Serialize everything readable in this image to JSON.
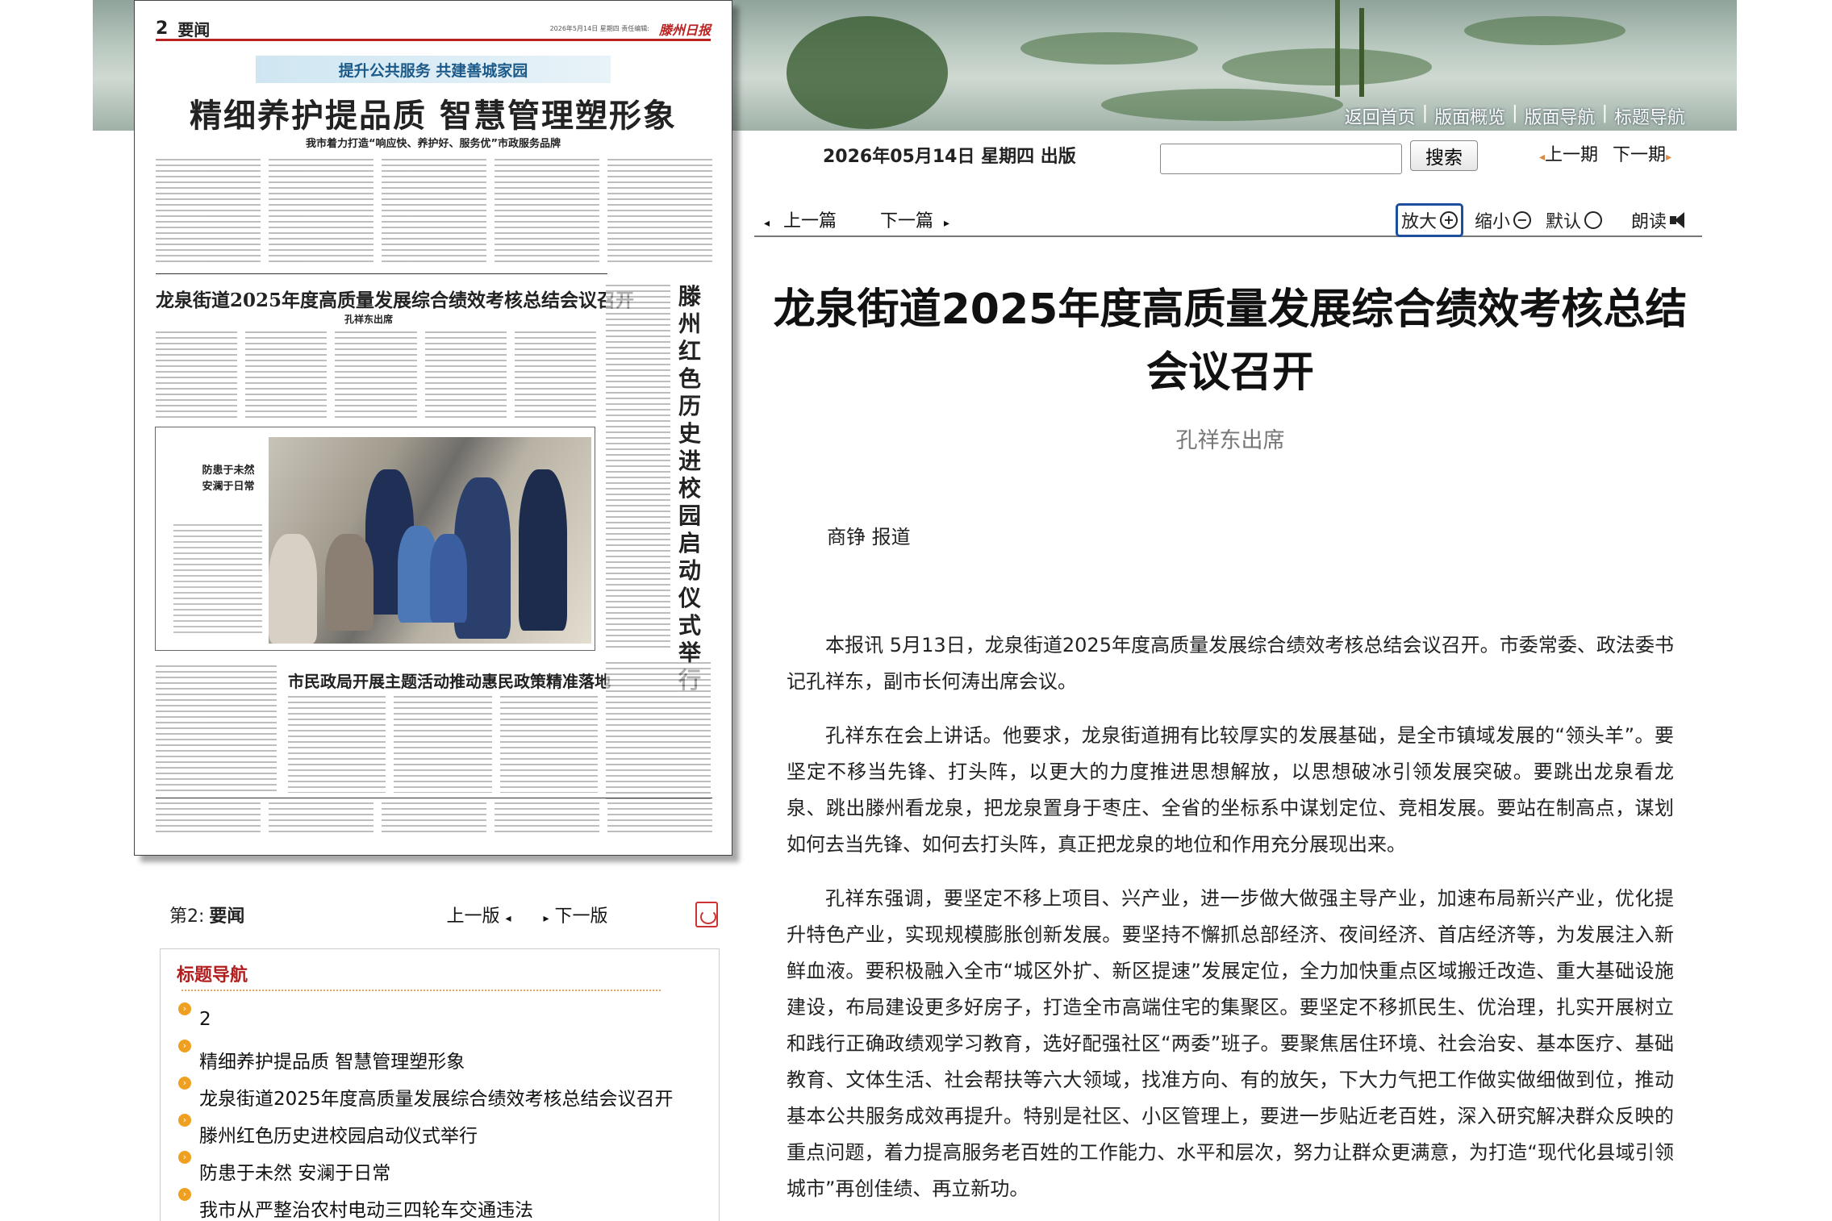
{
  "banner": {
    "links": [
      "返回首页",
      "版面概览",
      "版面导航",
      "标题导航"
    ]
  },
  "paper": {
    "page_no": "2",
    "page_name": "要闻",
    "meta": "2026年5月14日 星期四 责任编辑:",
    "sub_banner": "提升公共服务 共建善城家园",
    "headline": "精细养护提品质 智慧管理塑形象",
    "headline_sub": "我市着力打造“响应快、养护好、服务优”市政服务品牌",
    "h2_a": "龙泉街道2025年度高质量发展综合绩效考核总结会议召开",
    "h2_a_sub": "孔祥东出席",
    "vertical_head": "滕州红色历史进校园启动仪式举行",
    "caption_head": "防患于未然 安澜于日常",
    "h2_b": "市民政局开展主题活动推动惠民政策精准落地"
  },
  "page_nav": {
    "label": "第2:",
    "name": "要闻",
    "prev": "上一版",
    "next": "下一版",
    "pdf_icon": "pdf-icon"
  },
  "title_nav": {
    "heading": "标题导航",
    "items": [
      "2",
      "精细养护提品质 智慧管理塑形象",
      "龙泉街道2025年度高质量发展综合绩效考核总结会议召开",
      "滕州红色历史进校园启动仪式举行",
      "防患于未然 安澜于日常",
      "我市从严整治农村电动三四轮车交通违法"
    ]
  },
  "header": {
    "date": "2026年05月14日 星期四 出版",
    "search_value": "",
    "search_button": "搜索",
    "prev_issue": "上一期",
    "next_issue": "下一期"
  },
  "article_nav": {
    "prev": "上一篇",
    "next": "下一篇",
    "zoom_in": "放大",
    "zoom_out": "缩小",
    "default": "默认",
    "read": "朗读"
  },
  "article": {
    "title": "龙泉街道2025年度高质量发展综合绩效考核总结会议召开",
    "subtitle": "孔祥东出席",
    "byline": "商铮 报道",
    "paragraphs": [
      "本报讯 5月13日，龙泉街道2025年度高质量发展综合绩效考核总结会议召开。市委常委、政法委书记孔祥东，副市长何涛出席会议。",
      "孔祥东在会上讲话。他要求，龙泉街道拥有比较厚实的发展基础，是全市镇域发展的“领头羊”。要坚定不移当先锋、打头阵，以更大的力度推进思想解放，以思想破冰引领发展突破。要跳出龙泉看龙泉、跳出滕州看龙泉，把龙泉置身于枣庄、全省的坐标系中谋划定位、竞相发展。要站在制高点，谋划如何去当先锋、如何去打头阵，真正把龙泉的地位和作用充分展现出来。",
      "孔祥东强调，要坚定不移上项目、兴产业，进一步做大做强主导产业，加速布局新兴产业，优化提升特色产业，实现规模膨胀创新发展。要坚持不懈抓总部经济、夜间经济、首店经济等，为发展注入新鲜血液。要积极融入全市“城区外扩、新区提速”发展定位，全力加快重点区域搬迁改造、重大基础设施建设，布局建设更多好房子，打造全市高端住宅的集聚区。要坚定不移抓民生、优治理，扎实开展树立和践行正确政绩观学习教育，选好配强社区“两委”班子。要聚焦居住环境、社会治安、基本医疗、基础教育、文体生活、社会帮扶等六大领域，找准方向、有的放矢，下大力气把工作做实做细做到位，推动基本公共服务成效再提升。特别是社区、小区管理上，要进一步贴近老百姓，深入研究解决群众反映的重点问题，着力提高服务老百姓的工作能力、水平和层次，努力让群众更满意，为打造“现代化县域引领城市”再创佳绩、再立新功。"
    ]
  }
}
